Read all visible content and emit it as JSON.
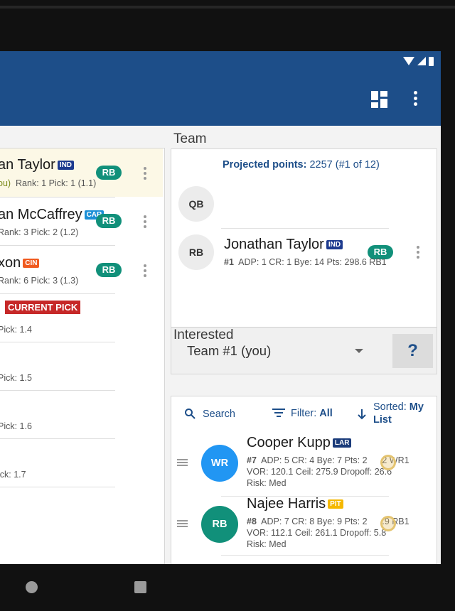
{
  "draft_board": {
    "rows": [
      {
        "name": "an Taylor",
        "team": "IND",
        "team_color": "#1d3b8f",
        "position": "RB",
        "meta_prefix": "ou)",
        "meta": "Rank: 1   Pick: 1 (1.1)"
      },
      {
        "name": "an McCaffrey",
        "team": "CAR",
        "team_color": "#1b8fd6",
        "position": "RB",
        "meta": "Rank: 3   Pick: 2 (1.2)"
      },
      {
        "name": "xon",
        "team": "CIN",
        "team_color": "#f05a1f",
        "position": "RB",
        "meta": "Rank: 6   Pick: 3 (1.3)"
      },
      {
        "current_pick_label": "CURRENT PICK",
        "meta": "Pick: 1.4"
      },
      {
        "meta": "Pick: 1.5"
      },
      {
        "meta": "Pick: 1.6"
      },
      {
        "meta": "ick: 1.7"
      }
    ]
  },
  "team": {
    "section_title": "Team",
    "projected_label": "Projected points:",
    "projected_value": "2257 (#1 of 12)",
    "slots": [
      {
        "position": "QB"
      },
      {
        "position": "RB",
        "player_name": "Jonathan Taylor",
        "team": "IND",
        "team_color": "#1d3b8f",
        "position_pill": "RB",
        "meta_rank": "#1",
        "meta": "ADP: 1   CR: 1   Bye: 14   Pts: 298.6   RB1"
      }
    ],
    "team_select_value": "Team #1 (you)",
    "help_label": "?"
  },
  "interested": {
    "section_title": "Interested",
    "search_label": "Search",
    "filter_label": "Filter:",
    "filter_value": "All",
    "sort_label": "Sorted:",
    "sort_value": "My",
    "sort_value_line2": "List",
    "players": [
      {
        "position": "WR",
        "color": "#2196f3",
        "name": "Cooper Kupp",
        "team": "LAR",
        "team_color": "#1a3b7a",
        "rank": "#7",
        "meta1": "ADP: 5   CR: 4   Bye: 7   Pts: 2      2   WR1",
        "meta2": "VOR: 120.1   Ceil: 275.9   Dropoff: 26.6",
        "meta3": "Risk: Med"
      },
      {
        "position": "RB",
        "color": "#11907a",
        "name": "Najee Harris",
        "team": "PIT",
        "team_color": "#f5b800",
        "rank": "#8",
        "meta1": "ADP: 7   CR: 8   Bye: 9   Pts: 2      .9   RB1",
        "meta2": "VOR: 112.1   Ceil: 261.1   Dropoff: 5.8",
        "meta3": "Risk: Med"
      }
    ]
  }
}
